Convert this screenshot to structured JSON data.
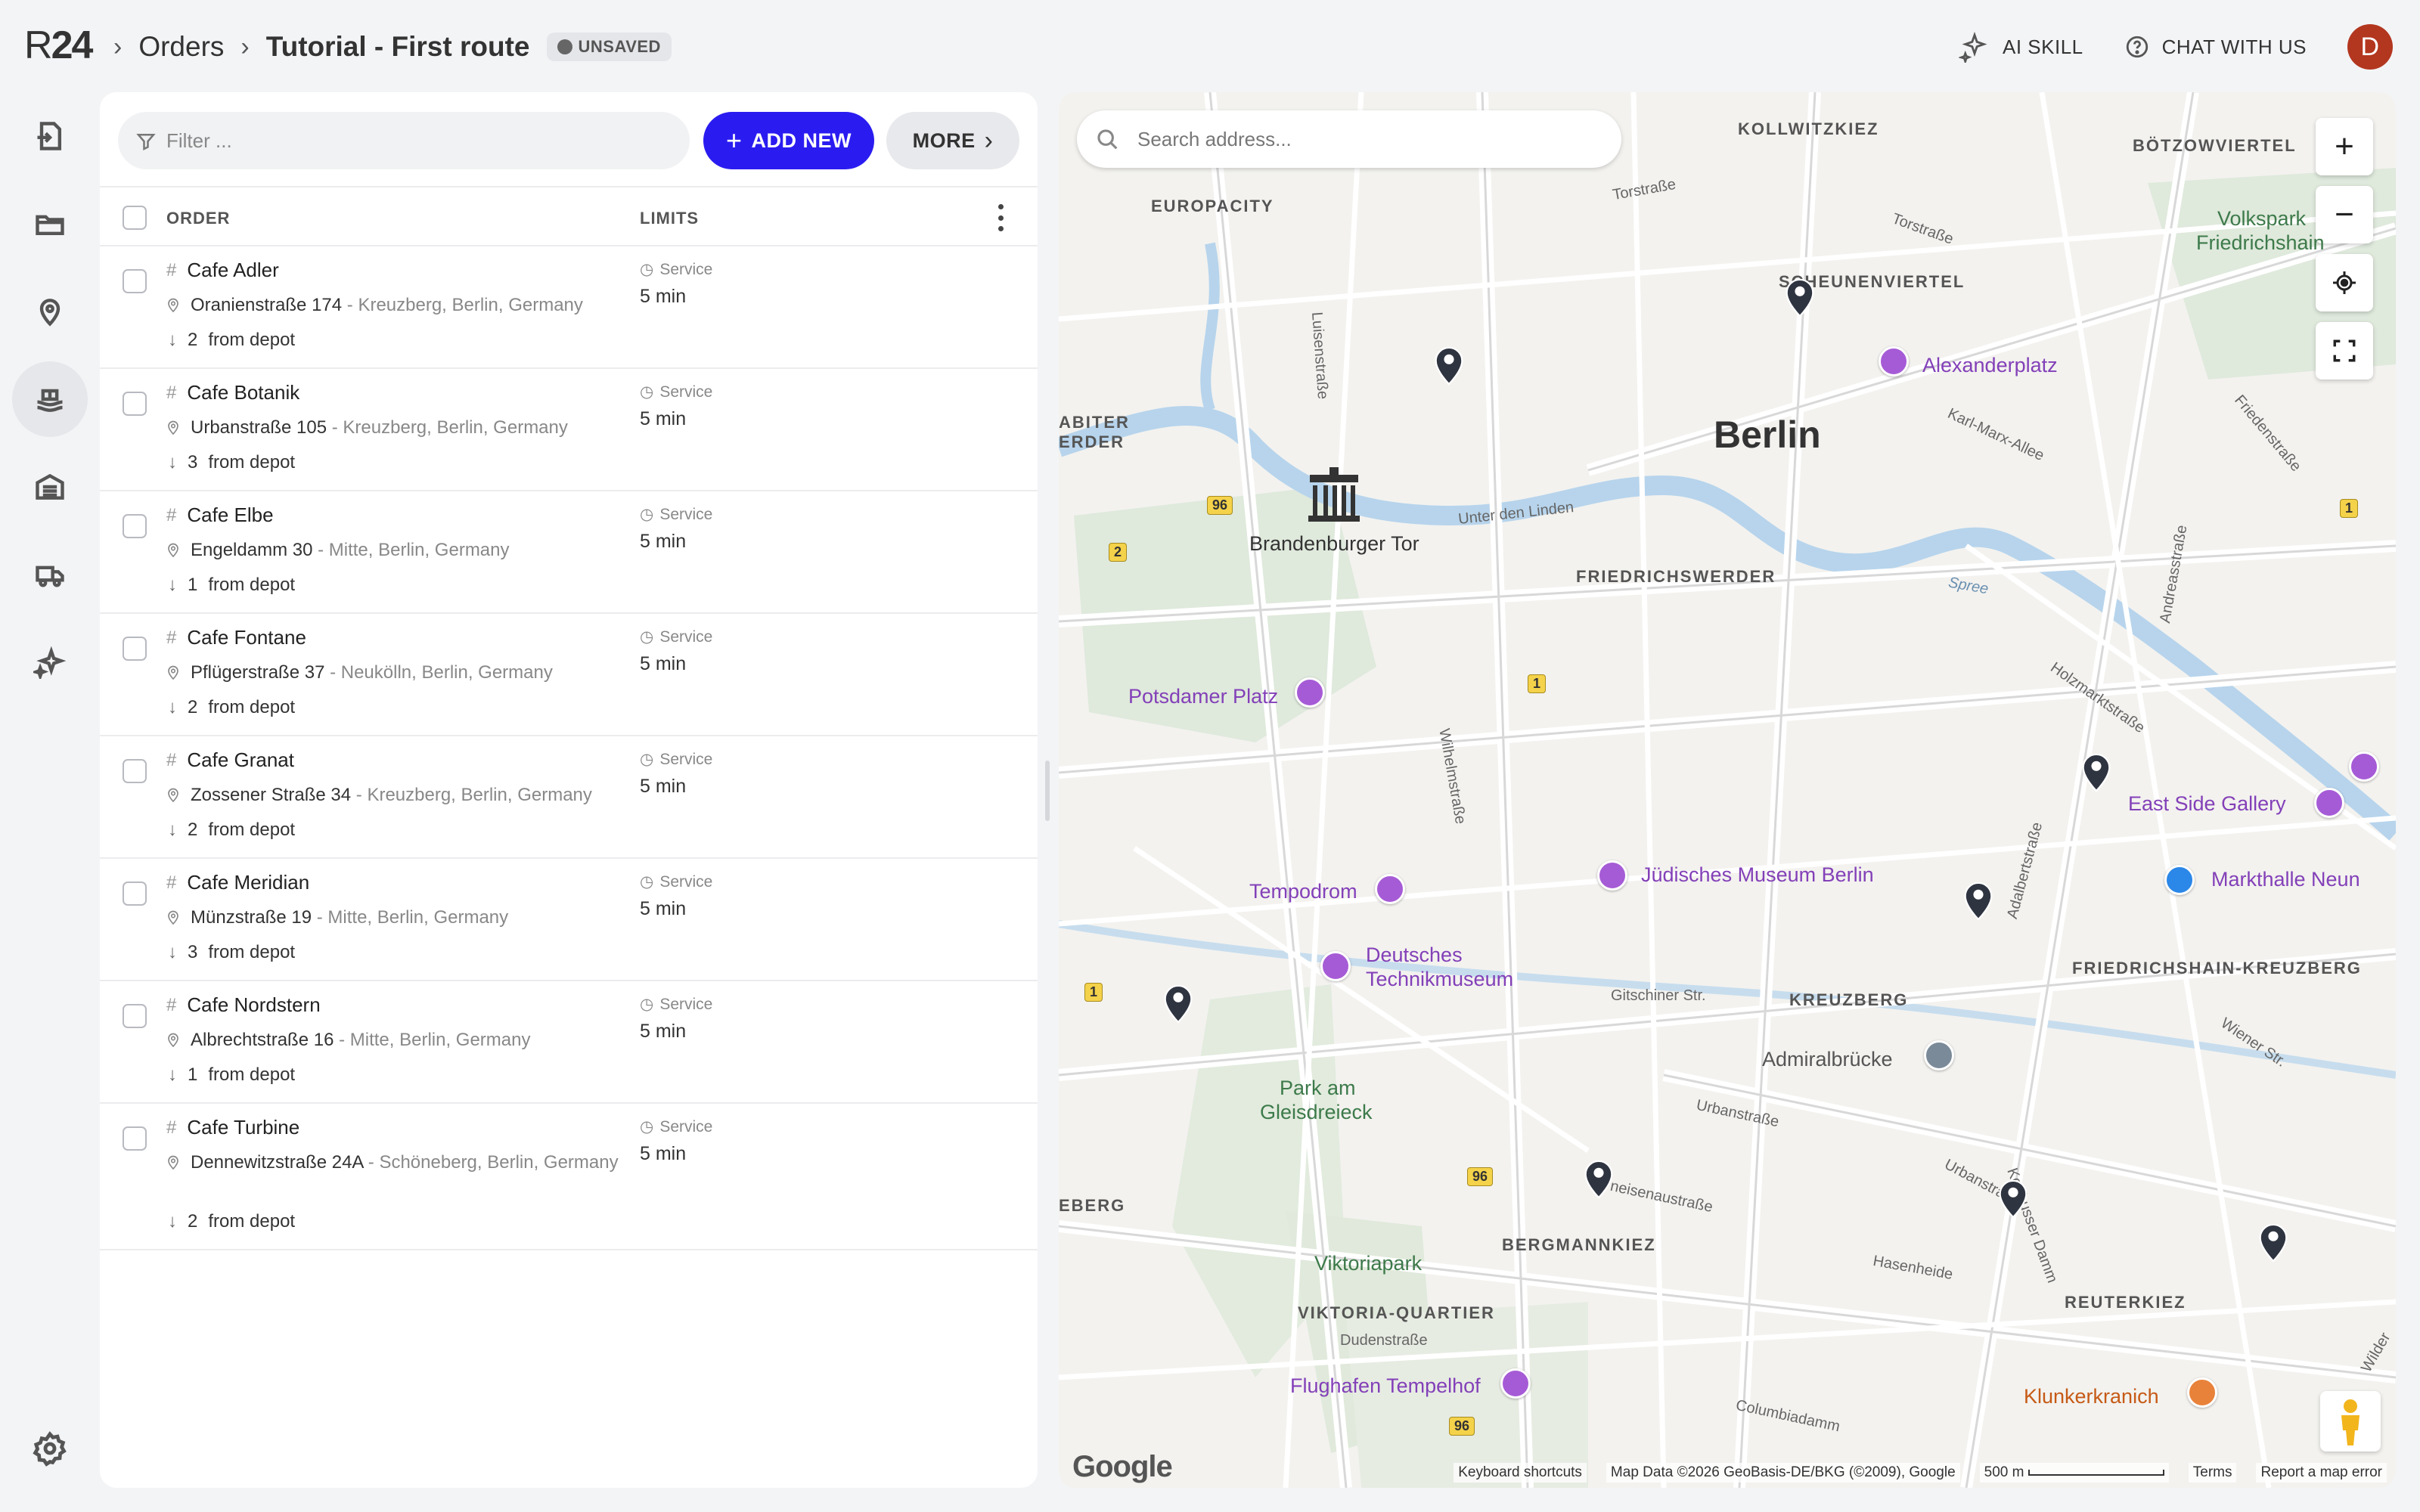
{
  "header": {
    "logo_r": "R",
    "logo_24": "24",
    "crumb_root": "Orders",
    "crumb_current": "Tutorial - First route",
    "badge": "UNSAVED",
    "ai_skill": "AI SKILL",
    "chat": "CHAT WITH US",
    "avatar_letter": "D"
  },
  "toolbar": {
    "filter_placeholder": "Filter ...",
    "add_new": "ADD NEW",
    "more": "MORE"
  },
  "table": {
    "col_order": "ORDER",
    "col_limits": "LIMITS",
    "rows": [
      {
        "name": "Cafe Adler",
        "street": "Oranienstraße 174",
        "area": " - Kreuzberg, Berlin, Germany",
        "depot_n": "2",
        "depot_label": "from depot",
        "service_label": "Service",
        "service_value": "5 min"
      },
      {
        "name": "Cafe Botanik",
        "street": "Urbanstraße 105",
        "area": " - Kreuzberg, Berlin, Germany",
        "depot_n": "3",
        "depot_label": "from depot",
        "service_label": "Service",
        "service_value": "5 min"
      },
      {
        "name": "Cafe Elbe",
        "street": "Engeldamm 30",
        "area": " - Mitte, Berlin, Germany",
        "depot_n": "1",
        "depot_label": "from depot",
        "service_label": "Service",
        "service_value": "5 min"
      },
      {
        "name": "Cafe Fontane",
        "street": "Pflügerstraße 37",
        "area": " - Neukölln, Berlin, Germany",
        "depot_n": "2",
        "depot_label": "from depot",
        "service_label": "Service",
        "service_value": "5 min"
      },
      {
        "name": "Cafe Granat",
        "street": "Zossener Straße 34",
        "area": " - Kreuzberg, Berlin, Germany",
        "depot_n": "2",
        "depot_label": "from depot",
        "service_label": "Service",
        "service_value": "5 min"
      },
      {
        "name": "Cafe Meridian",
        "street": "Münzstraße 19",
        "area": " - Mitte, Berlin, Germany",
        "depot_n": "3",
        "depot_label": "from depot",
        "service_label": "Service",
        "service_value": "5 min"
      },
      {
        "name": "Cafe Nordstern",
        "street": "Albrechtstraße 16",
        "area": " - Mitte, Berlin, Germany",
        "depot_n": "1",
        "depot_label": "from depot",
        "service_label": "Service",
        "service_value": "5 min"
      },
      {
        "name": "Cafe Turbine",
        "street": "Dennewitzstraße 24A",
        "area": " - Schöneberg, Berlin, Germany",
        "depot_n": "2",
        "depot_label": "from depot",
        "service_label": "Service",
        "service_value": "5 min"
      }
    ]
  },
  "map": {
    "search_placeholder": "Search address...",
    "zoom_in": "+",
    "zoom_out": "−",
    "labels": {
      "berlin": "Berlin",
      "kollwitzkiez": "KOLLWITZKIEZ",
      "boetzowviertel": "BÖTZOWVIERTEL",
      "europacity": "EUROPACITY",
      "scheunenviertel": "SCHEUNENVIERTEL",
      "friedrichswerder": "FRIEDRICHSWERDER",
      "friedrichshain_kreuzberg": "FRIEDRICHSHAIN-KREUZBERG",
      "kreuzberg": "KREUZBERG",
      "bergmannkiez": "BERGMANNKIEZ",
      "viktoria_quartier": "VIKTORIA-QUARTIER",
      "reuterkiez": "REUTERKIEZ",
      "abiter": "ABITER",
      "erder": "ERDER",
      "eberg": "EBERG",
      "alexanderplatz": "Alexanderplatz",
      "potsdamer_platz": "Potsdamer Platz",
      "brandenburger_tor": "Brandenburger Tor",
      "east_side_gallery": "East Side Gallery",
      "markthalle_neun": "Markthalle Neun",
      "juedisches_museum": "Jüdisches Museum Berlin",
      "tempodrom": "Tempodrom",
      "deutsches": "Deutsches",
      "technikmuseum": "Technikmuseum",
      "admiralbruecke": "Admiralbrücke",
      "park_am": "Park am",
      "gleisdreieck": "Gleisdreieck",
      "viktoriapark": "Viktoriapark",
      "flughafen_tempelhof": "Flughafen Tempelhof",
      "klunkerkranich": "Klunkerkranich",
      "volkspark": "Volkspark",
      "friedrichshain": "Friedrichshain",
      "torstrasse": "Torstraße",
      "torstrasse2": "Torstraße",
      "luisenstrasse": "Luisenstraße",
      "unter_den_linden": "Unter den Linden",
      "karl_marx_allee": "Karl-Marx-Allee",
      "friedenstrasse": "Friedenstraße",
      "andreasstrasse": "Andreasstraße",
      "holzmarktstrasse": "Holzmarktstraße",
      "spree": "Spree",
      "wilhelmstrasse": "Wilhelmstraße",
      "gitschiner": "Gitschiner Str.",
      "adalbertstrasse": "Adalbertstraße",
      "urbanstrasse": "Urbanstraße",
      "urbanstrasse2": "Urbanstraße",
      "kottbusser_damm": "Kottbusser Damm",
      "wiener_str": "Wiener Str.",
      "hasenheide": "Hasenheide",
      "columbiadamm": "Columbiadamm",
      "dudenstrasse": "Dudenstraße",
      "gneisenaustrasse": "neisenaustraße",
      "wilde": "Wilder",
      "r96": "96",
      "r96b": "96",
      "r96c": "96",
      "r1": "1",
      "r1b": "1",
      "r1c": "1",
      "r2": "2"
    },
    "footer": {
      "keyboard": "Keyboard shortcuts",
      "mapdata": "Map Data ©2026 GeoBasis-DE/BKG (©2009), Google",
      "scale": "500 m",
      "terms": "Terms",
      "report": "Report a map error"
    },
    "google": "Google"
  },
  "colors": {
    "accent": "#2a1cf0",
    "avatar": "#b3361f",
    "poi": "#8340b8",
    "pin": "#2e3440"
  }
}
